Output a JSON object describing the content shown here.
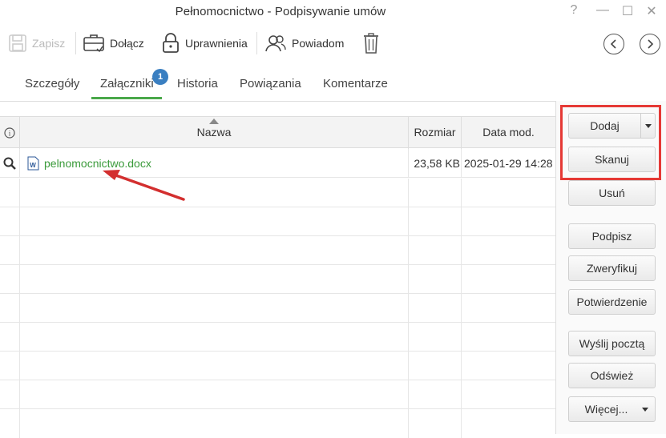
{
  "window": {
    "title": "Pełnomocnictwo - Podpisywanie umów",
    "controls": [
      "?",
      "—",
      "☐",
      "✕"
    ]
  },
  "toolbar": {
    "save_label": "Zapisz",
    "attach_label": "Dołącz",
    "permissions_label": "Uprawnienia",
    "notify_label": "Powiadom"
  },
  "tabs": {
    "items": [
      {
        "label": "Szczegóły"
      },
      {
        "label": "Załączniki",
        "active": true,
        "badge": "1"
      },
      {
        "label": "Historia"
      },
      {
        "label": "Powiązania"
      },
      {
        "label": "Komentarze"
      }
    ]
  },
  "table": {
    "columns": {
      "info": "i",
      "name": "Nazwa",
      "size": "Rozmiar",
      "date": "Data mod."
    },
    "rows": [
      {
        "name": "pelnomocnictwo.docx",
        "size": "23,58 KB",
        "date": "2025-01-29 14:28"
      }
    ]
  },
  "actions": {
    "add": "Dodaj",
    "scan": "Skanuj",
    "remove": "Usuń",
    "sign": "Podpisz",
    "verify": "Zweryfikuj",
    "confirmation": "Potwierdzenie",
    "send_post": "Wyślij pocztą",
    "refresh": "Odśwież",
    "more": "Więcej..."
  },
  "colors": {
    "accent_green": "#4aa84a",
    "badge_blue": "#3a7fc1",
    "highlight_red": "#e53935"
  }
}
